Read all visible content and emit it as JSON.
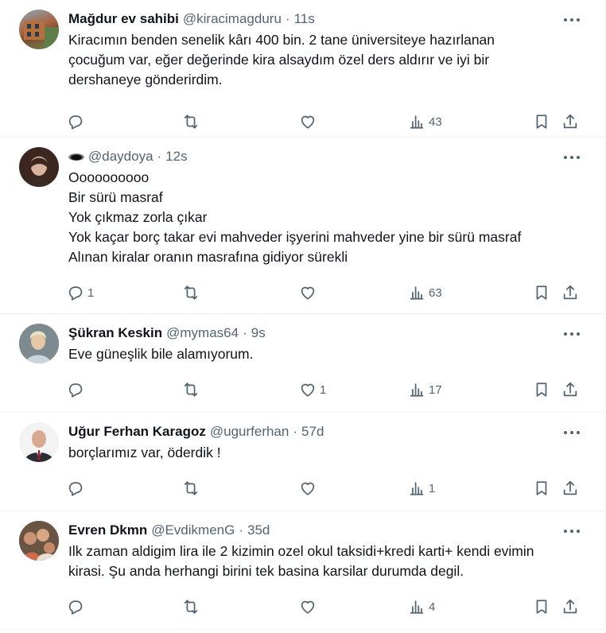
{
  "tweets": [
    {
      "name": "Mağdur ev sahibi",
      "handle": "@kiracimagduru",
      "time": "11s",
      "lines": [
        "Kiracımın benden senelik kârı 400 bin. 2 tane üniversiteye hazırlanan",
        "çocuğum var, eğer değerinde kira alsaydım özel ders aldırır ve iyi bir",
        "dershaneye gönderirdim."
      ],
      "replies": "",
      "likes": "",
      "views": "43"
    },
    {
      "name": "",
      "handle": "@daydoya",
      "time": "12s",
      "lines": [
        "Oooooooooo",
        "Bir sürü masraf",
        "Yok çıkmaz zorla çıkar",
        "Yok kaçar borç takar evi mahveder işyerini mahveder yine bir sürü masraf",
        "Alınan kiralar oranın masrafına gidiyor sürekli"
      ],
      "replies": "1",
      "likes": "",
      "views": "63"
    },
    {
      "name": "Şükran Keskin",
      "handle": "@mymas64",
      "time": "9s",
      "lines": [
        "Eve güneşlik bile alamıyorum."
      ],
      "replies": "",
      "likes": "1",
      "views": "17"
    },
    {
      "name": "Uğur Ferhan Karagoz",
      "handle": "@ugurferhan",
      "time": "57d",
      "lines": [
        "borçlarımız var, öderdik !"
      ],
      "replies": "",
      "likes": "",
      "views": "1"
    },
    {
      "name": "Evren Dkmn",
      "handle": "@EvdikmenG",
      "time": "35d",
      "lines": [
        "Ilk zaman aldigim lira ile 2 kizimin ozel okul taksidi+kredi karti+ kendi evimin",
        "kirasi. Şu anda herhangi birini tek basina karsilar durumda degil."
      ],
      "replies": "",
      "likes": "",
      "views": "4"
    }
  ],
  "icons": {
    "reply": "reply-icon",
    "retweet": "retweet-icon",
    "like": "heart-icon",
    "views": "views-icon",
    "bookmark": "bookmark-icon",
    "share": "share-icon",
    "more": "more-icon",
    "name_emoji": "black-circle-emoji-icon"
  },
  "colors": {
    "text": "#0f1419",
    "secondary": "#536471",
    "border": "#eff3f4"
  }
}
